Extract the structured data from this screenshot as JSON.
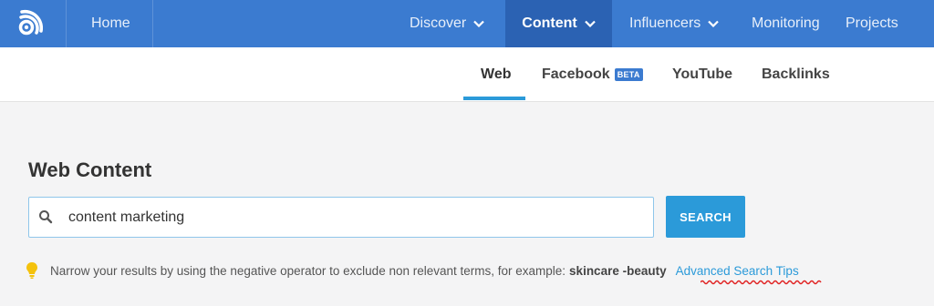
{
  "nav": {
    "home": "Home",
    "discover": "Discover",
    "content": "Content",
    "influencers": "Influencers",
    "monitoring": "Monitoring",
    "projects": "Projects"
  },
  "subnav": {
    "web": "Web",
    "facebook": "Facebook",
    "beta": "BETA",
    "youtube": "YouTube",
    "backlinks": "Backlinks"
  },
  "main": {
    "title": "Web Content",
    "search_value": "content marketing",
    "search_button": "SEARCH"
  },
  "tip": {
    "text": "Narrow your results by using the negative operator to exclude non relevant terms, for example:",
    "example": "skincare -beauty",
    "link": "Advanced Search Tips"
  },
  "colors": {
    "nav_bg": "#3b7bd0",
    "nav_active": "#2b62b3",
    "accent": "#2b9ad9"
  },
  "icons": [
    "rss-logo-icon",
    "chevron-down-icon",
    "search-icon",
    "lightbulb-icon"
  ]
}
